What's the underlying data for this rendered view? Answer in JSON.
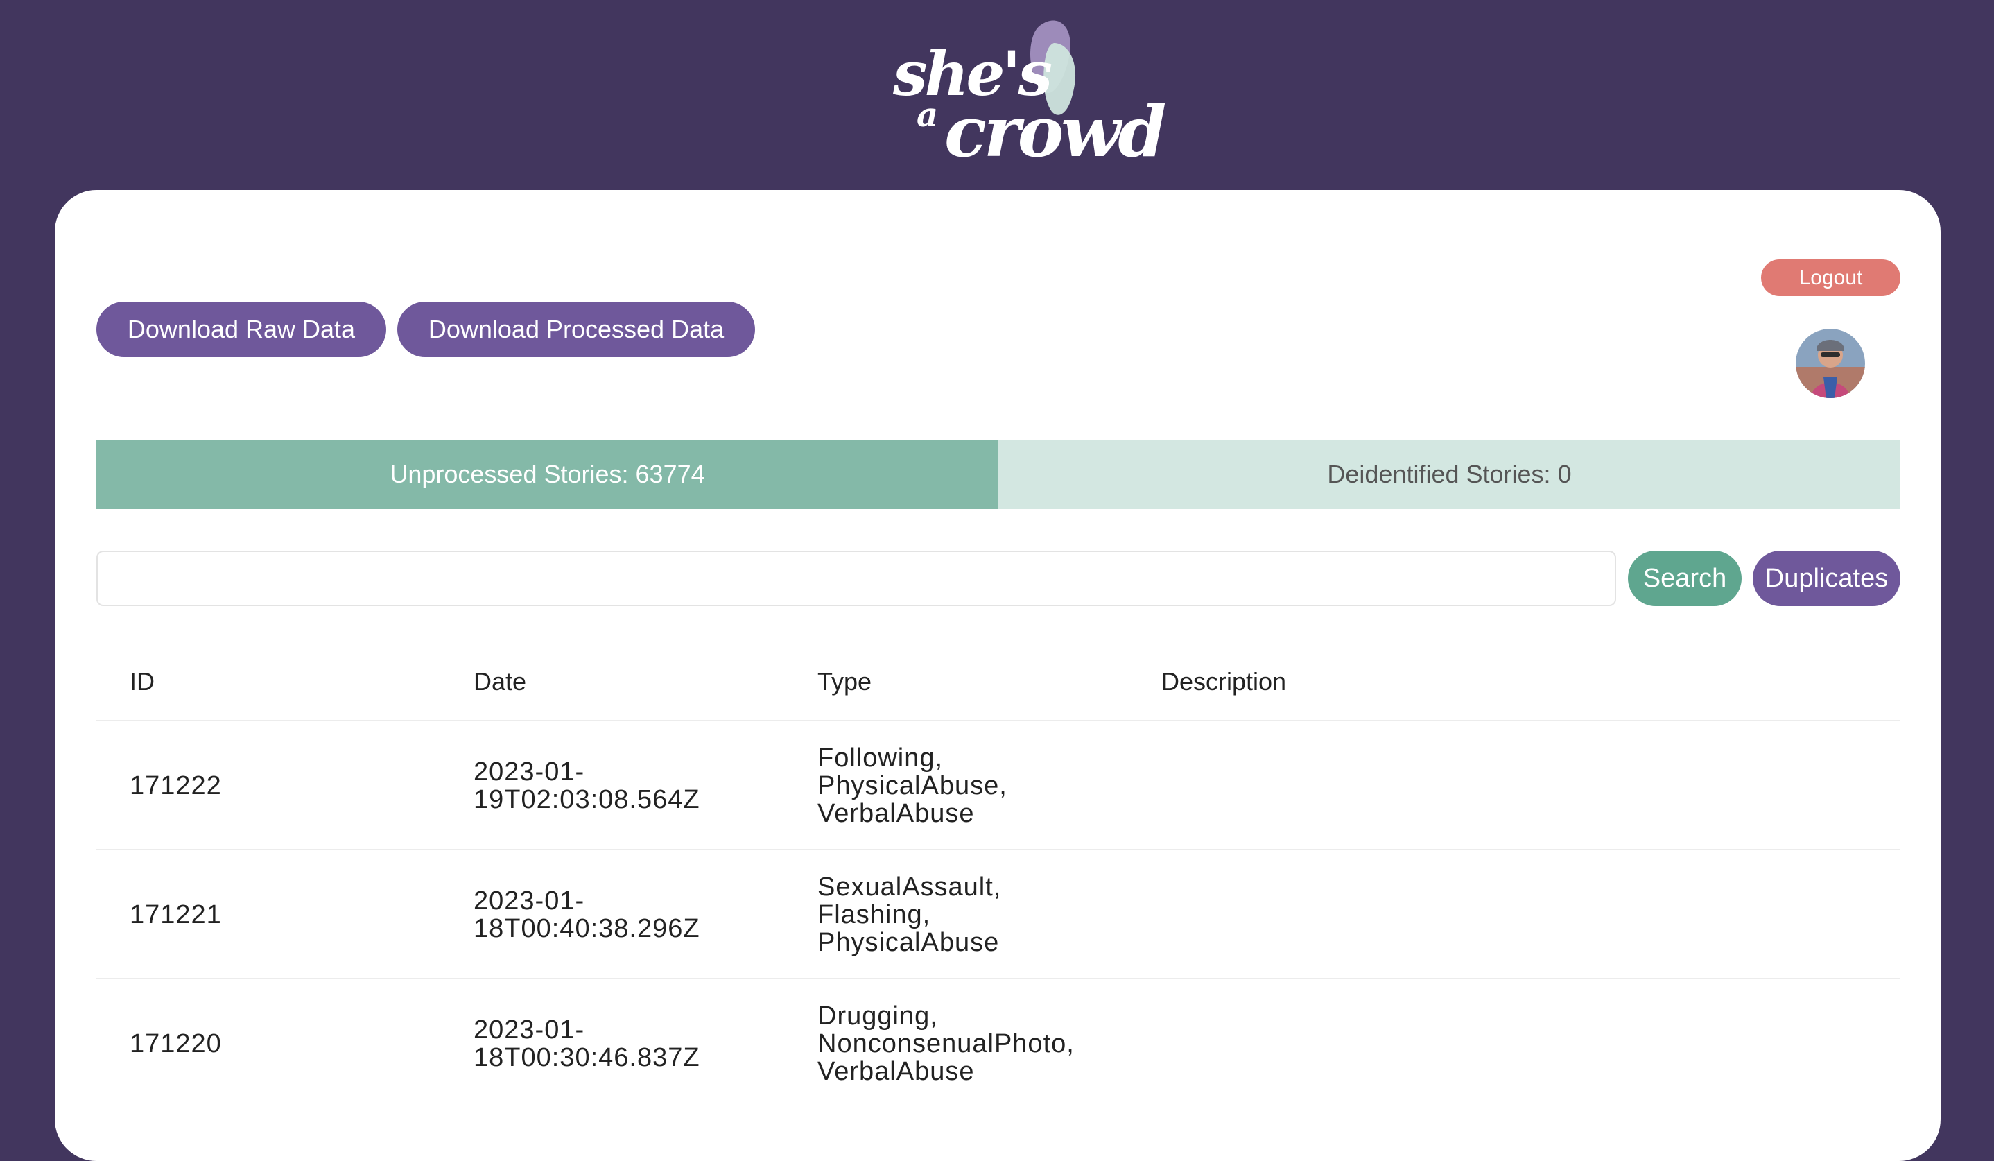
{
  "brand": {
    "logo_line1": "she's",
    "logo_line2": "a",
    "logo_line3": "crowd"
  },
  "header": {
    "download_raw_label": "Download Raw Data",
    "download_processed_label": "Download Processed Data",
    "logout_label": "Logout"
  },
  "tabs": [
    {
      "label": "Unprocessed Stories: 63774",
      "active": true
    },
    {
      "label": "Deidentified Stories: 0",
      "active": false
    }
  ],
  "search": {
    "value": "",
    "placeholder": "",
    "search_label": "Search",
    "duplicates_label": "Duplicates"
  },
  "table": {
    "columns": [
      "ID",
      "Date",
      "Type",
      "Description"
    ],
    "rows": [
      {
        "id": "171222",
        "date": "2023-01-\n19T02:03:08.564Z",
        "type": "Following,\nPhysicalAbuse,\nVerbalAbuse",
        "description": ""
      },
      {
        "id": "171221",
        "date": "2023-01-\n18T00:40:38.296Z",
        "type": "SexualAssault,\nFlashing,\nPhysicalAbuse",
        "description": ""
      },
      {
        "id": "171220",
        "date": "2023-01-\n18T00:30:46.837Z",
        "type": "Drugging,\nNonconsenualPhoto,\nVerbalAbuse",
        "description": ""
      }
    ]
  },
  "colors": {
    "background": "#42365e",
    "primary_purple": "#6f589b",
    "accent_green": "#5fa68f",
    "tab_active": "#84b9a8",
    "tab_inactive": "#d3e7e1",
    "logout_red": "#e07a73"
  }
}
